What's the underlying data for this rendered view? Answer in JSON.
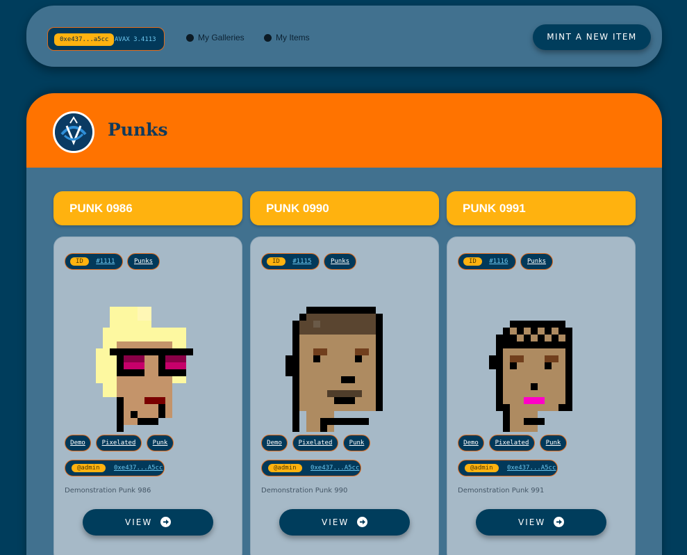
{
  "nav": {
    "wallet_address": "0xe437...a5cc",
    "wallet_balance": "AVAX 3.4113",
    "links": [
      "My Galleries",
      "My Items"
    ],
    "mint_label": "MINT A NEW ITEM"
  },
  "gallery": {
    "title": "Punks",
    "accent": "#ff7300",
    "items": [
      {
        "name": "PUNK 0986",
        "id_label": "ID",
        "id": "#1111",
        "collection": "Punks",
        "tags": [
          "Demo",
          "Pixelated",
          "Punk"
        ],
        "owner_label": "@admin",
        "owner": "0xe437...A5cc",
        "description": "Demonstration Punk 986",
        "view_label": "VIEW",
        "icon": "arrow-right-icon"
      },
      {
        "name": "PUNK 0990",
        "id_label": "ID",
        "id": "#1115",
        "collection": "Punks",
        "tags": [
          "Demo",
          "Pixelated",
          "Punk"
        ],
        "owner_label": "@admin",
        "owner": "0xe437...A5cc",
        "description": "Demonstration Punk 990",
        "view_label": "VIEW",
        "icon": "arrow-right-icon"
      },
      {
        "name": "PUNK 0991",
        "id_label": "ID",
        "id": "#1116",
        "collection": "Punks",
        "tags": [
          "Demo",
          "Pixelated",
          "Punk"
        ],
        "owner_label": "@admin",
        "owner": "0xe437...A5cc",
        "description": "Demonstration Punk 991",
        "view_label": "VIEW",
        "icon": "arrow-right-icon"
      }
    ]
  }
}
